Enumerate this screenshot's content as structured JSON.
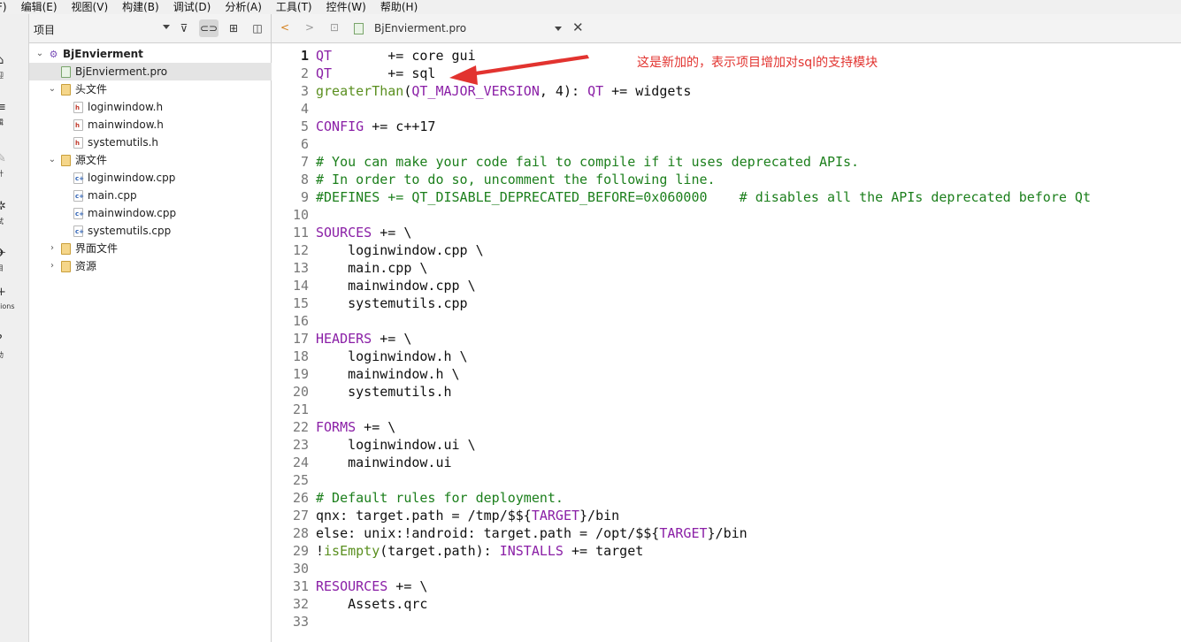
{
  "menubar": [
    "F)",
    "编辑(E)",
    "视图(V)",
    "构建(B)",
    "调试(D)",
    "分析(A)",
    "工具(T)",
    "控件(W)",
    "帮助(H)"
  ],
  "modes": [
    {
      "icon": "⌂",
      "label": "迎"
    },
    {
      "icon": "≡",
      "label": "辑"
    },
    {
      "icon": "✎",
      "label": "计"
    },
    {
      "icon": "✲",
      "label": "试"
    },
    {
      "icon": "✈",
      "label": "目"
    },
    {
      "icon": "+",
      "label": "sions"
    },
    {
      "icon": "?",
      "label": "助"
    }
  ],
  "project_panel": {
    "title": "项目",
    "tree": [
      {
        "label": "BjEnvierment",
        "type": "proj",
        "level": 0,
        "expanded": true
      },
      {
        "label": "BjEnvierment.pro",
        "type": "pro",
        "level": 1,
        "selected": true
      },
      {
        "label": "头文件",
        "type": "folder",
        "level": 1,
        "expanded": true,
        "mark": "h"
      },
      {
        "label": "loginwindow.h",
        "type": "h",
        "level": 2
      },
      {
        "label": "mainwindow.h",
        "type": "h",
        "level": 2
      },
      {
        "label": "systemutils.h",
        "type": "h",
        "level": 2
      },
      {
        "label": "源文件",
        "type": "folder",
        "level": 1,
        "expanded": true,
        "mark": "c"
      },
      {
        "label": "loginwindow.cpp",
        "type": "cpp",
        "level": 2
      },
      {
        "label": "main.cpp",
        "type": "cpp",
        "level": 2
      },
      {
        "label": "mainwindow.cpp",
        "type": "cpp",
        "level": 2
      },
      {
        "label": "systemutils.cpp",
        "type": "cpp",
        "level": 2
      },
      {
        "label": "界面文件",
        "type": "folder",
        "level": 1,
        "expanded": false
      },
      {
        "label": "资源",
        "type": "folder",
        "level": 1,
        "expanded": false
      }
    ]
  },
  "editor": {
    "file_name": "BjEnvierment.pro",
    "current_line": 1,
    "lines": [
      [
        [
          "QT       ",
          "kw"
        ],
        [
          "+= core gui",
          ""
        ]
      ],
      [
        [
          "QT       ",
          "kw"
        ],
        [
          "+= sql",
          ""
        ]
      ],
      [
        [
          "greaterThan",
          "fn"
        ],
        [
          "(",
          ""
        ],
        [
          "QT_MAJOR_VERSION",
          "kw"
        ],
        [
          ", 4): ",
          ""
        ],
        [
          "QT",
          "kw"
        ],
        [
          " += widgets",
          ""
        ]
      ],
      [],
      [
        [
          "CONFIG",
          "kw"
        ],
        [
          " += c++17",
          ""
        ]
      ],
      [],
      [
        [
          "# You can make your code fail to compile if it uses deprecated APIs.",
          "cm"
        ]
      ],
      [
        [
          "# In order to do so, uncomment the following line.",
          "cm"
        ]
      ],
      [
        [
          "#DEFINES += QT_DISABLE_DEPRECATED_BEFORE=0x060000    # disables all the APIs deprecated before Qt",
          "cm"
        ]
      ],
      [],
      [
        [
          "SOURCES",
          "kw"
        ],
        [
          " += \\",
          ""
        ]
      ],
      [
        [
          "    loginwindow.cpp \\",
          ""
        ]
      ],
      [
        [
          "    main.cpp \\",
          ""
        ]
      ],
      [
        [
          "    mainwindow.cpp \\",
          ""
        ]
      ],
      [
        [
          "    systemutils.cpp",
          ""
        ]
      ],
      [],
      [
        [
          "HEADERS",
          "kw"
        ],
        [
          " += \\",
          ""
        ]
      ],
      [
        [
          "    loginwindow.h \\",
          ""
        ]
      ],
      [
        [
          "    mainwindow.h \\",
          ""
        ]
      ],
      [
        [
          "    systemutils.h",
          ""
        ]
      ],
      [],
      [
        [
          "FORMS",
          "kw"
        ],
        [
          " += \\",
          ""
        ]
      ],
      [
        [
          "    loginwindow.ui \\",
          ""
        ]
      ],
      [
        [
          "    mainwindow.ui",
          ""
        ]
      ],
      [],
      [
        [
          "# Default rules for deployment.",
          "cm"
        ]
      ],
      [
        [
          "qnx: target.path = /tmp/$${",
          ""
        ],
        [
          "TARGET",
          "kw"
        ],
        [
          "}/bin",
          ""
        ]
      ],
      [
        [
          "else: unix:!android: target.path = /opt/$${",
          ""
        ],
        [
          "TARGET",
          "kw"
        ],
        [
          "}/bin",
          ""
        ]
      ],
      [
        [
          "!",
          ""
        ],
        [
          "isEmpty",
          "fn"
        ],
        [
          "(target.path): ",
          ""
        ],
        [
          "INSTALLS",
          "kw"
        ],
        [
          " += target",
          ""
        ]
      ],
      [],
      [
        [
          "RESOURCES",
          "kw"
        ],
        [
          " += \\",
          ""
        ]
      ],
      [
        [
          "    Assets.qrc",
          ""
        ]
      ],
      []
    ]
  },
  "annotation": {
    "text": "这是新加的，表示项目增加对sql的支持模块",
    "color": "#e2332f"
  }
}
